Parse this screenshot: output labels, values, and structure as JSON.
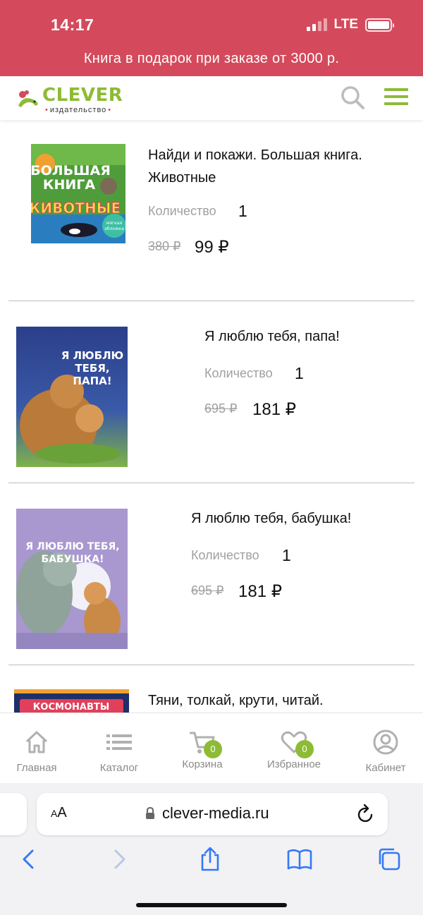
{
  "status_bar": {
    "time": "14:17",
    "network": "LTE"
  },
  "promo_banner": "Книга в подарок при заказе от 3000 р.",
  "header": {
    "logo_text": "CLEVER",
    "logo_subtitle": "издательство",
    "search_icon": "search-icon",
    "menu_icon": "hamburger-menu-icon"
  },
  "colors": {
    "brand_red": "#d44a5c",
    "brand_green": "#8dbb35",
    "muted": "#a0a0a0"
  },
  "cart_items": [
    {
      "title": "Найди и покажи. Большая книга. Животные",
      "qty_label": "Количество",
      "qty": "1",
      "old_price": "380 ₽",
      "price": "99 ₽"
    },
    {
      "title": "Я люблю тебя, папа!",
      "qty_label": "Количество",
      "qty": "1",
      "old_price": "695 ₽",
      "price": "181 ₽"
    },
    {
      "title": "Я люблю тебя, бабушка!",
      "qty_label": "Количество",
      "qty": "1",
      "old_price": "695 ₽",
      "price": "181 ₽"
    },
    {
      "title": "Тяни, толкай, крути, читай."
    }
  ],
  "bottom_nav": [
    {
      "label": "Главная",
      "icon": "home-icon"
    },
    {
      "label": "Каталог",
      "icon": "list-icon"
    },
    {
      "label": "Корзина",
      "icon": "cart-icon",
      "badge": "0"
    },
    {
      "label": "Избранное",
      "icon": "heart-icon",
      "badge": "0"
    },
    {
      "label": "Кабинет",
      "icon": "user-icon"
    }
  ],
  "browser": {
    "text_size_label": "AA",
    "url": "clever-media.ru"
  }
}
